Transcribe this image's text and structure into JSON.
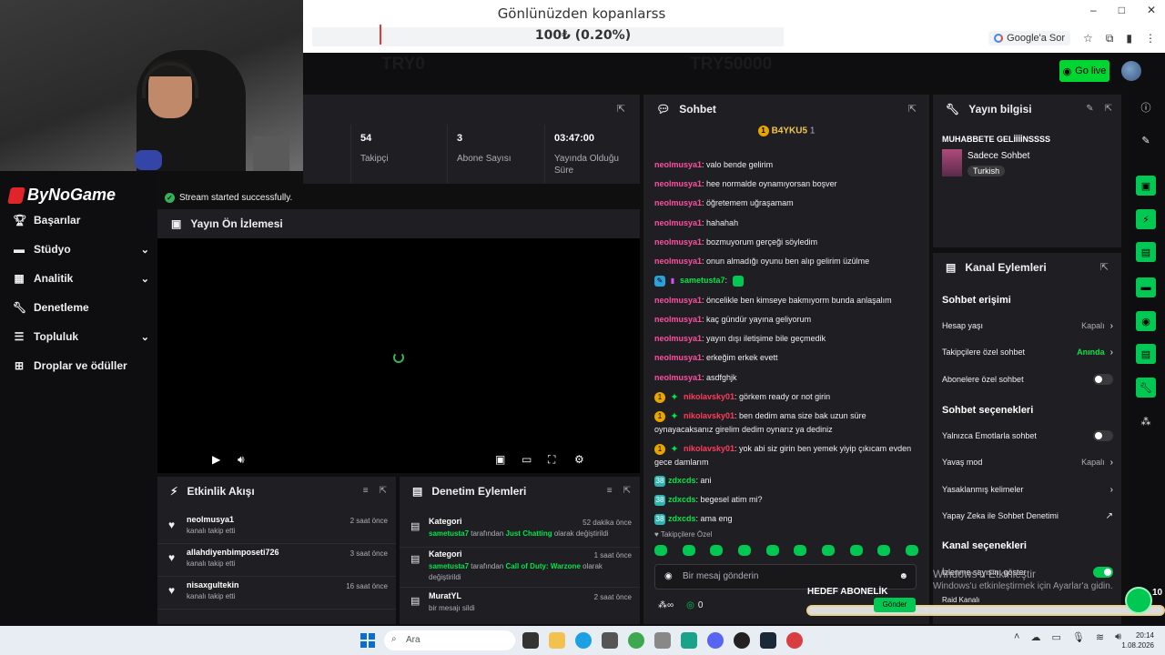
{
  "browser": {
    "alert_title": "Gönlünüzden kopanlarss",
    "alert_amount": "100₺ (0.20%)",
    "google_label": "Google'a Sor",
    "win_min": "–",
    "win_max": "□",
    "win_close": "✕"
  },
  "topbar": {
    "ghost_left": "TRY0",
    "ghost_right": "TRY50000",
    "golive_label": "Go live"
  },
  "sidebar": {
    "logo": "ByNoGame",
    "items": [
      {
        "label": "Başarılar",
        "icon": "trophy-icon"
      },
      {
        "label": "Stüdyo",
        "icon": "studio-icon"
      },
      {
        "label": "Analitik",
        "icon": "analytics-icon"
      },
      {
        "label": "Denetleme",
        "icon": "wrench-icon"
      },
      {
        "label": "Topluluk",
        "icon": "community-icon"
      },
      {
        "label": "Droplar ve ödüller",
        "icon": "drops-icon"
      }
    ]
  },
  "stats": [
    {
      "value": "54",
      "label": "Takipçi"
    },
    {
      "value": "3",
      "label": "Abone Sayısı"
    },
    {
      "value": "03:47:00",
      "label": "Yayında Olduğu Süre"
    }
  ],
  "toast": "Stream started successfully.",
  "preview": {
    "title": "Yayın Ön İzlemesi"
  },
  "feed": {
    "title": "Etkinlik Akışı",
    "rows": [
      {
        "name": "neolmusya1",
        "sub": "kanalı takip etti",
        "time": "2 saat önce"
      },
      {
        "name": "allahdiyenbimposeti726",
        "sub": "kanalı takip etti",
        "time": "3 saat önce"
      },
      {
        "name": "nisaxgultekin",
        "sub": "kanalı takip etti",
        "time": "16 saat önce"
      }
    ]
  },
  "modact": {
    "title": "Denetim Eylemleri",
    "rows": [
      {
        "title": "Kategori",
        "user": "sametusta7",
        "mid": " tarafından ",
        "target": "Just Chatting",
        "end": " olarak değiştirildi",
        "time": "52 dakika önce"
      },
      {
        "title": "Kategori",
        "user": "sametusta7",
        "mid": " tarafından ",
        "target": "Call of Duty: Warzone",
        "end": " olarak değiştirildi",
        "time": "1 saat önce"
      },
      {
        "title": "MuratYL",
        "user": "",
        "mid": "",
        "target": "",
        "end": "bir mesajı sildi",
        "time": "2 saat önce"
      }
    ]
  },
  "chat": {
    "title": "Sohbet",
    "top_user": "B4YKU5",
    "top_count": "1",
    "messages": [
      {
        "nick": "neolmusya1",
        "text": ": valo bende gelirim",
        "color": "pink"
      },
      {
        "nick": "neolmusya1",
        "text": ": hee normalde oynamıyorsan boşver",
        "color": "pink"
      },
      {
        "nick": "neolmusya1",
        "text": ": öğretemem uğraşamam",
        "color": "pink"
      },
      {
        "nick": "neolmusya1",
        "text": ": hahahah",
        "color": "pink"
      },
      {
        "nick": "neolmusya1",
        "text": ": bozmuyorum gerçeği söyledim",
        "color": "pink"
      },
      {
        "nick": "neolmusya1",
        "text": ": onun almadığı oyunu ben alıp gelirim üzülme",
        "color": "pink"
      },
      {
        "nick": "sametusta7",
        "text": ":",
        "color": "green"
      },
      {
        "nick": "neolmusya1",
        "text": ": öncelikle ben kimseye bakmıyorm bunda anlaşalım",
        "color": "pink"
      },
      {
        "nick": "neolmusya1",
        "text": ": kaç gündür yayına geliyorum",
        "color": "pink"
      },
      {
        "nick": "neolmusya1",
        "text": ": yayın dışı iletişime bile geçmedik",
        "color": "pink"
      },
      {
        "nick": "neolmusya1",
        "text": ": erkeğim erkek evett",
        "color": "pink"
      },
      {
        "nick": "neolmusya1",
        "text": ": asdfghjk",
        "color": "pink"
      },
      {
        "nick": "nikolavsky01",
        "text": ": görkem ready or not girin",
        "color": "red"
      },
      {
        "nick": "nikolavsky01",
        "text": ": ben dedim ama size bak uzun süre oynayacaksanız girelim dedim oynarız ya dediniz",
        "color": "red"
      },
      {
        "nick": "nikolavsky01",
        "text": ": yok abi siz girin ben yemek yiyip çıkıcam evden gece damlarım",
        "color": "red"
      },
      {
        "nick": "zdxcds",
        "text": ": ani",
        "color": "green"
      },
      {
        "nick": "zdxcds",
        "text": ": begesel atim mi?",
        "color": "green"
      },
      {
        "nick": "zdxcds",
        "text": ": ama eng",
        "color": "green"
      }
    ],
    "follower_only": "Takipçilere Özel",
    "input_placeholder": "Bir mesaj gönderin",
    "footer_count": "0",
    "send_label": "Gönder"
  },
  "info": {
    "title": "Yayın bilgisi",
    "stream_title": "MUHABBETE GELİİİİNSSSS",
    "category": "Sadece Sohbet",
    "tag": "Turkish"
  },
  "channel": {
    "title": "Kanal Eylemleri",
    "sec_access": "Sohbet erişimi",
    "account_age": "Hesap yaşı",
    "account_age_val": "Kapalı",
    "follower_chat": "Takipçilere özel sohbet",
    "follower_chat_val": "Anında",
    "sub_chat": "Abonelere özel sohbet",
    "sec_options": "Sohbet seçenekleri",
    "emote_only": "Yalnızca Emotlarla sohbet",
    "slow_mode": "Yavaş mod",
    "slow_mode_val": "Kapalı",
    "banned_words": "Yasaklanmış kelimeler",
    "ai_mod": "Yapay Zeka ile Sohbet Denetimi",
    "sec_channel": "Kanal seçenekleri",
    "viewer_count": "İzlenme sayısını göster",
    "raid": "Raid Kanalı"
  },
  "overlay": {
    "goal_label": "HEDEF ABONELİK",
    "win_activate_title": "Windows'u Etkinleştir",
    "win_activate_sub": "Windows'u etkinleştirmek için Ayarlar'a gidin.",
    "right_num": "10"
  },
  "taskbar": {
    "search": "Ara",
    "time": "20:14",
    "date": "1.08.2026"
  },
  "colors": {
    "accent": "#00c853",
    "panel": "#1f1f23",
    "pink": "#ff4fa0",
    "green": "#00e54a"
  }
}
